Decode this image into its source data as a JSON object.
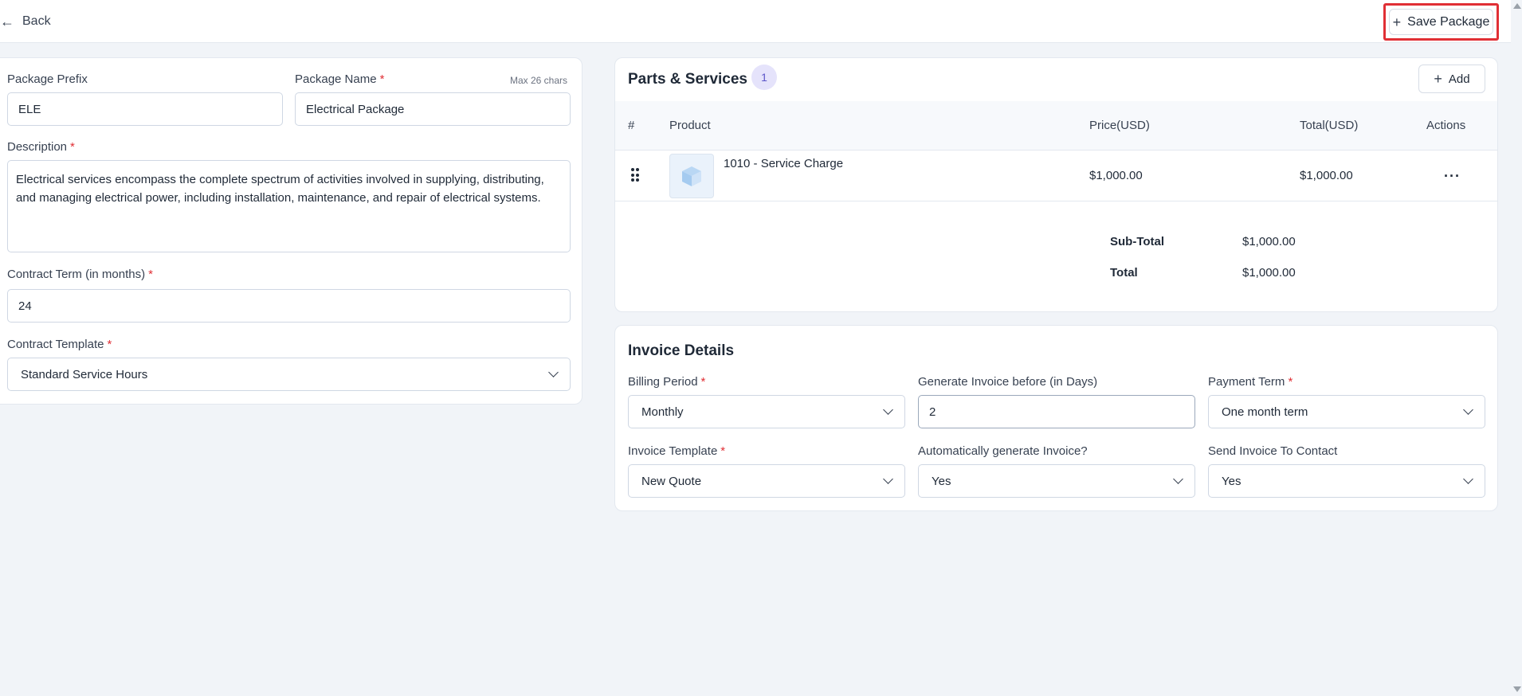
{
  "header": {
    "back_label": "Back",
    "save_label": "Save Package"
  },
  "form": {
    "prefix_label": "Package Prefix",
    "prefix_value": "ELE",
    "name_label": "Package Name",
    "name_value": "Electrical Package",
    "name_hint": "Max 26 chars",
    "description_label": "Description",
    "description_value": "Electrical services encompass the complete spectrum of activities involved in supplying, distributing, and managing electrical power, including installation, maintenance, and repair of electrical systems.",
    "term_label": "Contract Term (in months)",
    "term_value": "24",
    "template_label": "Contract Template",
    "template_value": "Standard Service Hours",
    "required_mark": "*"
  },
  "parts": {
    "title": "Parts & Services",
    "count": "1",
    "add_label": "Add",
    "columns": [
      "#",
      "Product",
      "Price(USD)",
      "Total(USD)",
      "Actions"
    ],
    "rows": [
      {
        "product": "1010 - Service Charge",
        "price": "$1,000.00",
        "total": "$1,000.00"
      }
    ],
    "subtotal_label": "Sub-Total",
    "subtotal_value": "$1,000.00",
    "total_label": "Total",
    "total_value": "$1,000.00"
  },
  "invoice": {
    "title": "Invoice Details",
    "billing_period_label": "Billing Period",
    "billing_period_value": "Monthly",
    "generate_before_label": "Generate Invoice before (in Days)",
    "generate_before_value": "2",
    "payment_term_label": "Payment Term",
    "payment_term_value": "One month term",
    "invoice_template_label": "Invoice Template",
    "invoice_template_value": "New Quote",
    "auto_generate_label": "Automatically generate Invoice?",
    "auto_generate_value": "Yes",
    "send_to_contact_label": "Send Invoice To Contact",
    "send_to_contact_value": "Yes"
  },
  "colors": {
    "required": "#e02f35",
    "highlight": "#e02f35",
    "badge_bg": "#e5e3fb",
    "page_bg": "#f1f4f8"
  },
  "icons": [
    "arrow-left-icon",
    "plus-icon",
    "drag-handle-icon",
    "box-icon",
    "more-icon",
    "chevron-down-icon"
  ]
}
